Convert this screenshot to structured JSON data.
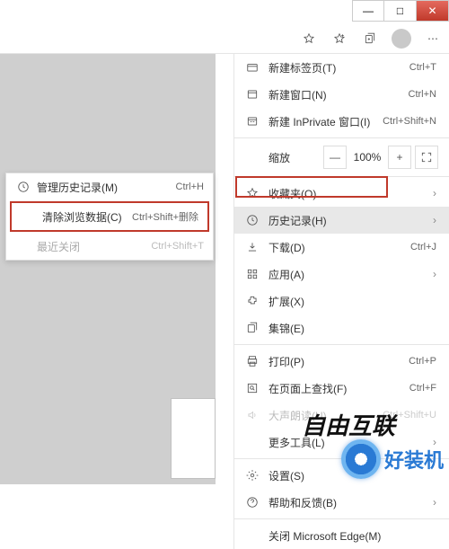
{
  "titlebar": {
    "min": "—",
    "max": "□",
    "close": "✕"
  },
  "toolbar": {
    "dots": "⋯"
  },
  "history_popup": {
    "manage": {
      "label": "管理历史记录(M)",
      "shortcut": "Ctrl+H"
    },
    "clear": {
      "label": "清除浏览数据(C)",
      "shortcut": "Ctrl+Shift+删除"
    },
    "recent": {
      "label": "最近关闭",
      "shortcut": "Ctrl+Shift+T"
    }
  },
  "menu": {
    "new_tab": {
      "label": "新建标签页(T)",
      "shortcut": "Ctrl+T"
    },
    "new_window": {
      "label": "新建窗口(N)",
      "shortcut": "Ctrl+N"
    },
    "new_inprivate": {
      "label": "新建 InPrivate 窗口(I)",
      "shortcut": "Ctrl+Shift+N"
    },
    "zoom": {
      "label": "缩放",
      "minus": "—",
      "value": "100%",
      "plus": "+"
    },
    "favorites": {
      "label": "收藏夹(O)"
    },
    "history": {
      "label": "历史记录(H)"
    },
    "downloads": {
      "label": "下载(D)",
      "shortcut": "Ctrl+J"
    },
    "apps": {
      "label": "应用(A)"
    },
    "extensions": {
      "label": "扩展(X)"
    },
    "collections": {
      "label": "集锦(E)"
    },
    "print": {
      "label": "打印(P)",
      "shortcut": "Ctrl+P"
    },
    "find": {
      "label": "在页面上查找(F)",
      "shortcut": "Ctrl+F"
    },
    "read_aloud": {
      "label": "大声朗读(U)",
      "shortcut": "Ctrl+Shift+U"
    },
    "more_tools": {
      "label": "更多工具(L)"
    },
    "settings": {
      "label": "设置(S)"
    },
    "help": {
      "label": "帮助和反馈(B)"
    },
    "close_edge": {
      "label": "关闭 Microsoft Edge(M)"
    }
  },
  "watermark1": "自由互联",
  "watermark2": "好装机"
}
